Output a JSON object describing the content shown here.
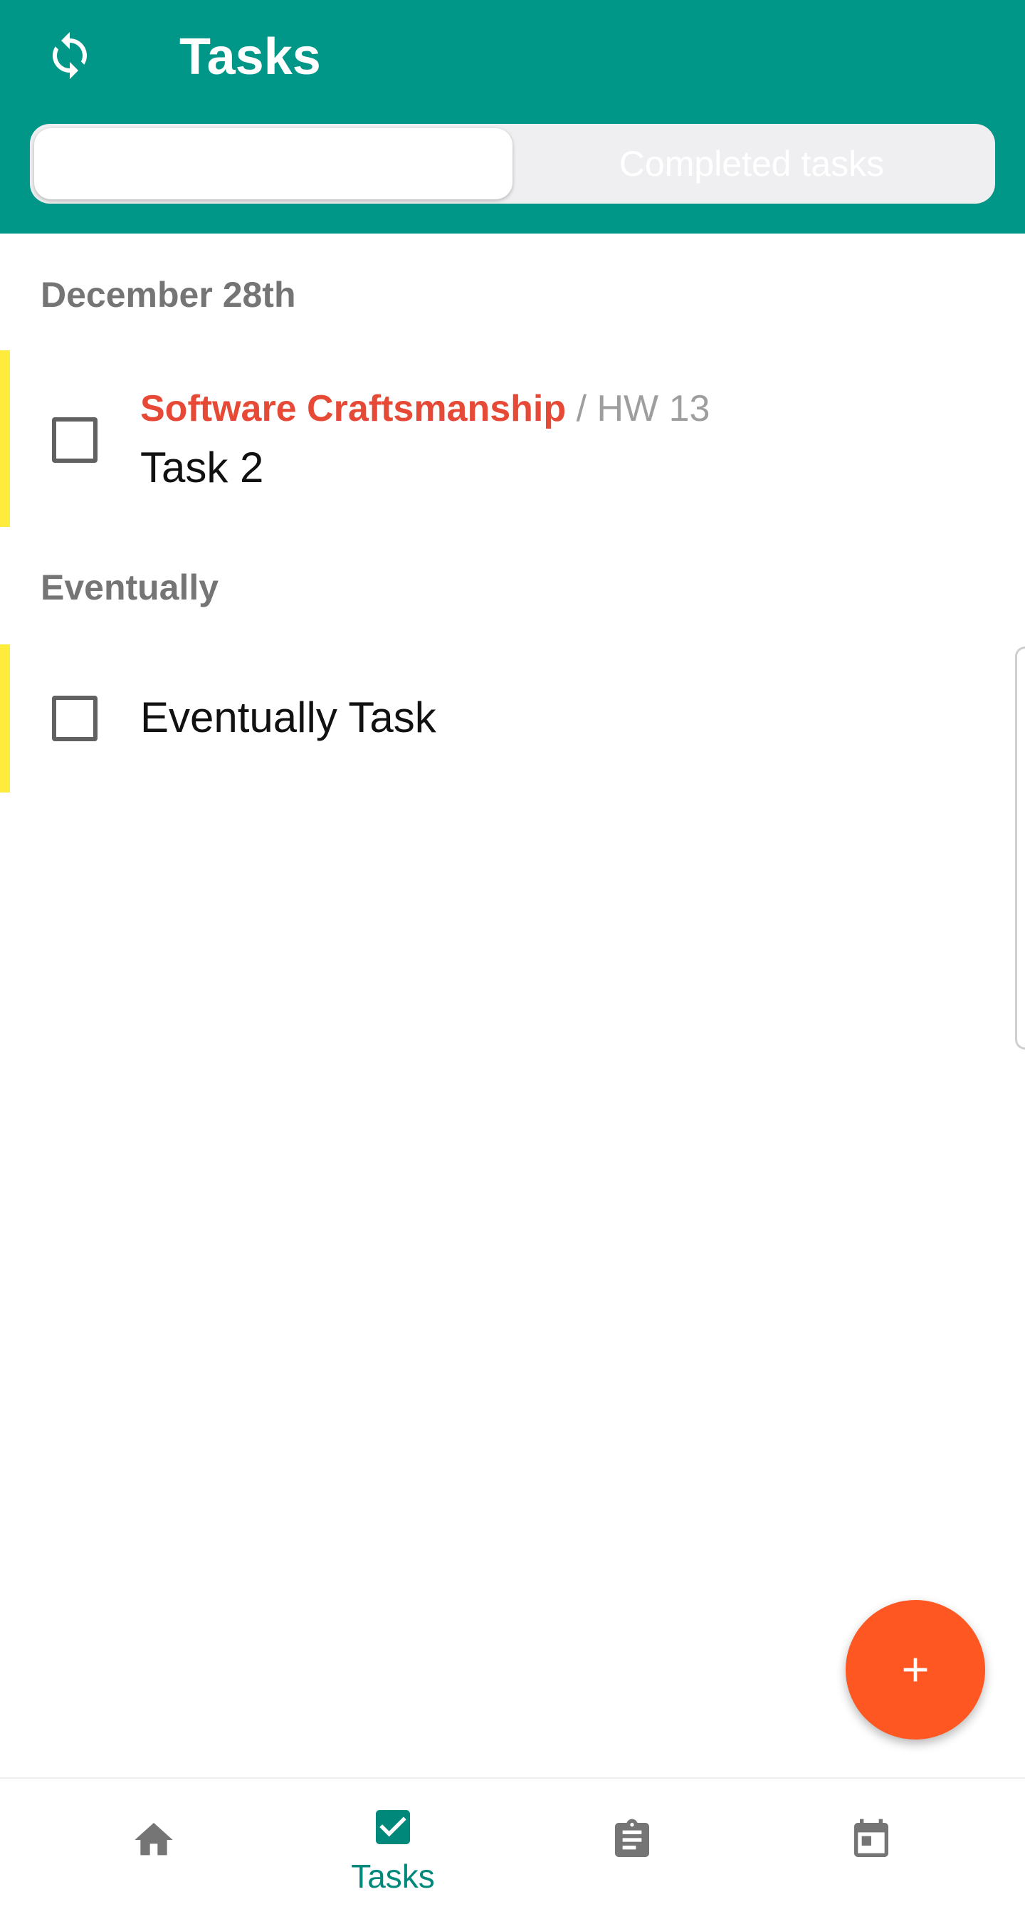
{
  "header": {
    "title": "Tasks",
    "sync_icon": "sync-icon",
    "tabs": [
      {
        "label": "",
        "active": true
      },
      {
        "label": "Completed tasks",
        "active": false
      }
    ]
  },
  "sections": [
    {
      "label": "December 28th",
      "tasks": [
        {
          "course": "Software Craftsmanship",
          "assignment": "/ HW 13",
          "title": "Task 2",
          "checked": false,
          "stripe_color": "#ffeb3b"
        }
      ]
    },
    {
      "label": "Eventually",
      "tasks": [
        {
          "course": "",
          "assignment": "",
          "title": "Eventually Task",
          "checked": false,
          "stripe_color": "#ffeb3b"
        }
      ]
    }
  ],
  "fab": {
    "icon": "plus-icon",
    "color": "#ff5722"
  },
  "bottom_nav": [
    {
      "icon": "home-icon",
      "label": "",
      "active": false
    },
    {
      "icon": "checkbox-icon",
      "label": "Tasks",
      "active": true
    },
    {
      "icon": "clipboard-icon",
      "label": "",
      "active": false
    },
    {
      "icon": "calendar-icon",
      "label": "",
      "active": false
    }
  ],
  "colors": {
    "primary": "#009688",
    "accent": "#ff5722",
    "course_red": "#e64a36",
    "nav_active": "#00897b"
  }
}
